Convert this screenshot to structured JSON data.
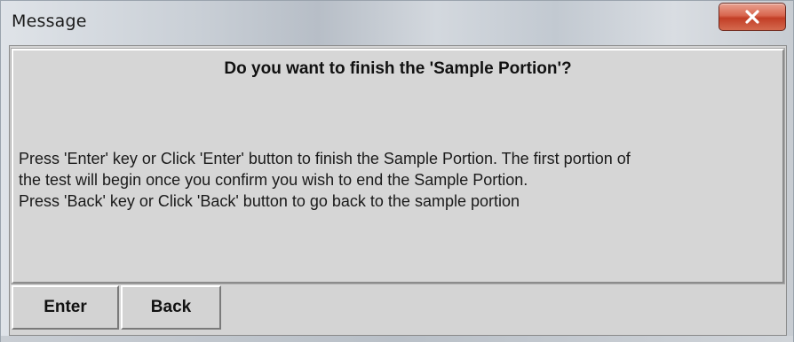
{
  "window": {
    "title": "Message",
    "close_icon": "close-x-icon",
    "close_color": "#c8432b"
  },
  "message": {
    "heading": "Do you want to finish the 'Sample Portion'?",
    "lines": [
      "Press 'Enter' key or Click 'Enter' button to finish the Sample Portion. The first portion of",
      "the test will begin once you confirm you wish to end the Sample Portion.",
      "Press 'Back' key or Click 'Back' button to go back to the sample portion"
    ]
  },
  "buttons": {
    "enter_label": "Enter",
    "back_label": "Back"
  }
}
